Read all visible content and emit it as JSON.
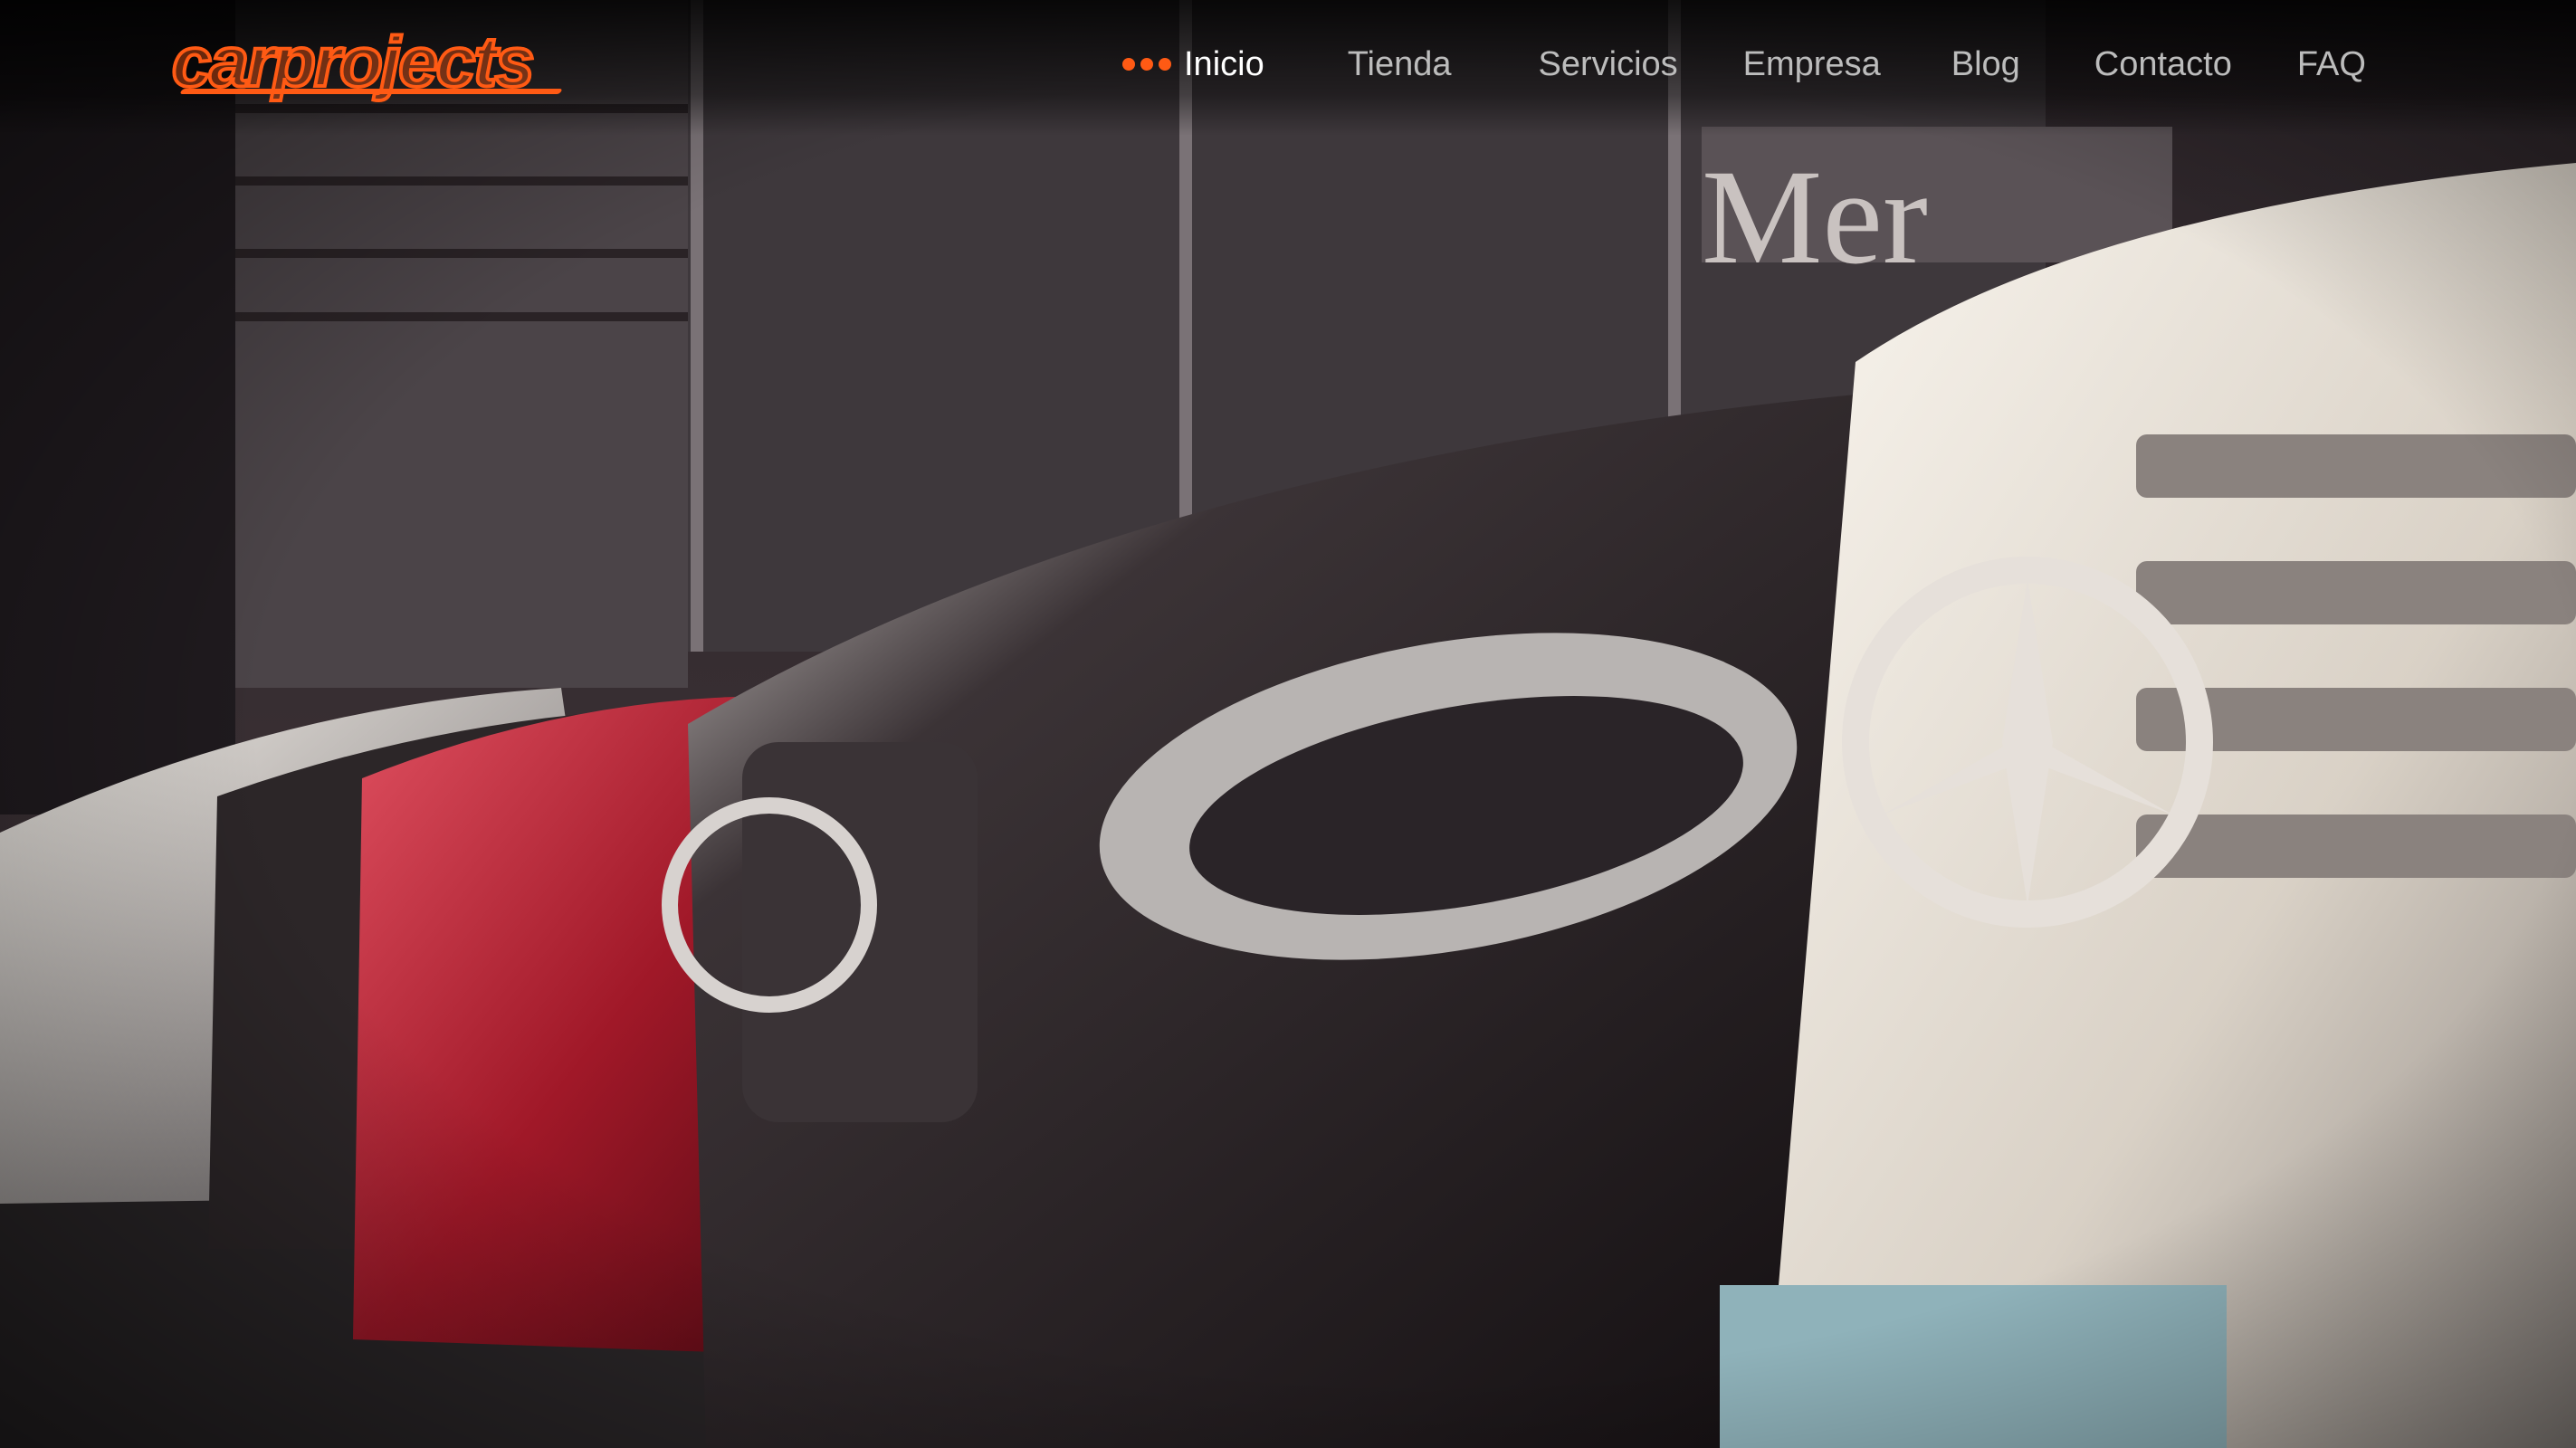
{
  "brand": {
    "logo_text": "carprojects",
    "accent_color": "#ff5a14"
  },
  "nav": {
    "items": [
      {
        "label": "Inicio",
        "active": true
      },
      {
        "label": "Tienda",
        "active": false
      },
      {
        "label": "Servicios",
        "active": false
      },
      {
        "label": "Empresa",
        "active": false
      },
      {
        "label": "Blog",
        "active": false
      },
      {
        "label": "Contacto",
        "active": false
      },
      {
        "label": "FAQ",
        "active": false
      }
    ],
    "active_marker_icon": "three-dots-icon"
  },
  "hero": {
    "image": "row-of-mercedes-cars-at-dealership-photo"
  }
}
